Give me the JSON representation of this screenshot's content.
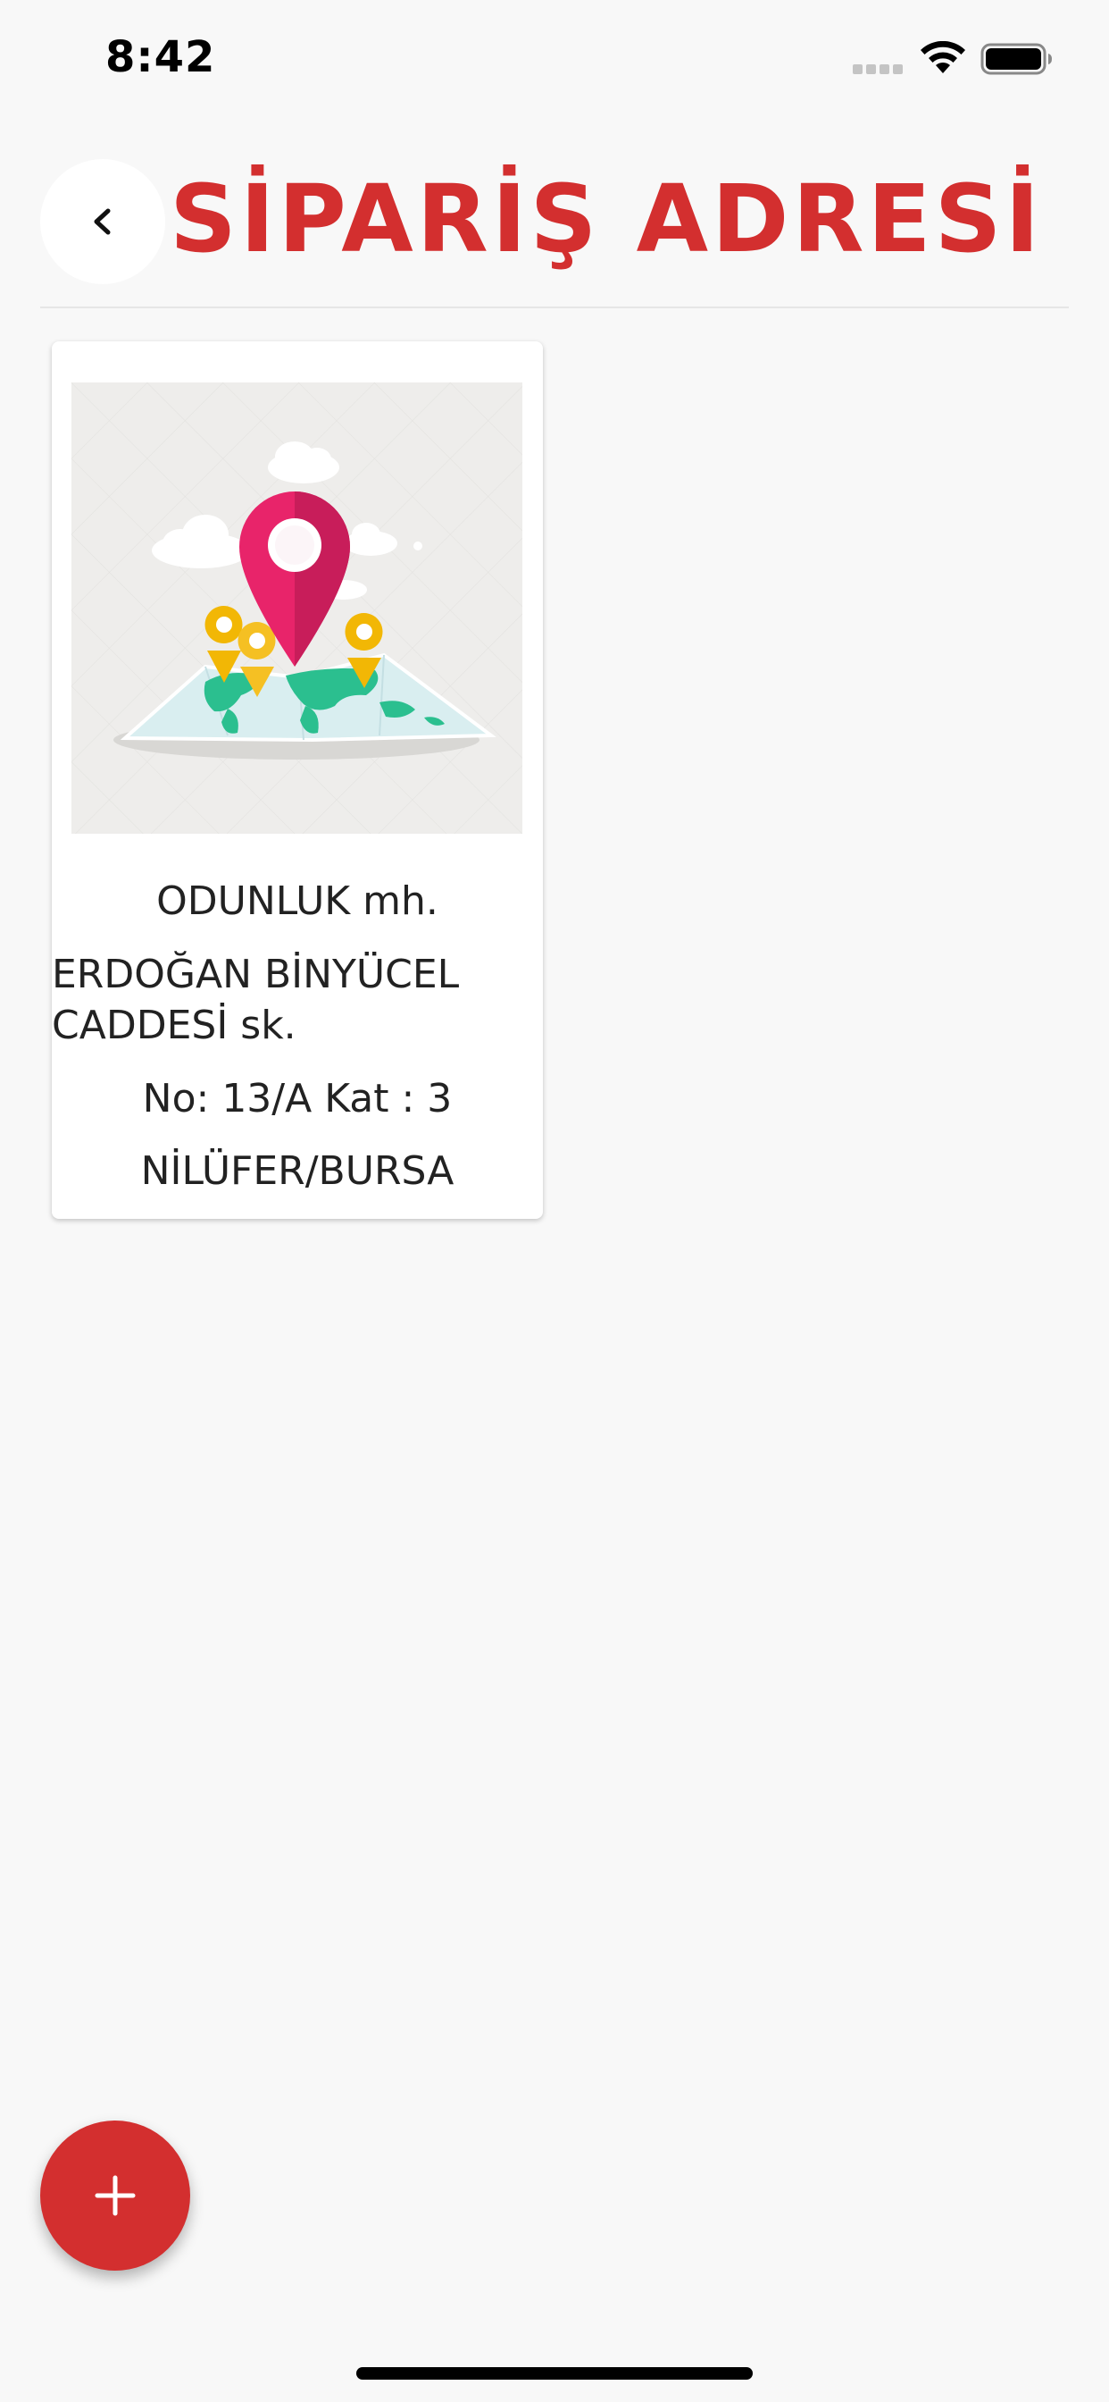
{
  "status_bar": {
    "time": "8:42",
    "icons": [
      "signal-dots-icon",
      "wifi-icon",
      "battery-icon"
    ]
  },
  "header": {
    "back_icon": "chevron-left-icon",
    "title": "SİPARİŞ ADRESİ"
  },
  "addresses": [
    {
      "image_icon": "map-pin-icon",
      "neighborhood": "ODUNLUK mh.",
      "street": "ERDOĞAN BİNYÜCEL CADDESİ  sk.",
      "number_floor": "No: 13/A Kat : 3",
      "district_city": "NİLÜFER/BURSA"
    }
  ],
  "fab": {
    "icon": "plus-icon"
  },
  "colors": {
    "accent": "#d32f2f",
    "background": "#f8f8f8",
    "card": "#ffffff"
  }
}
